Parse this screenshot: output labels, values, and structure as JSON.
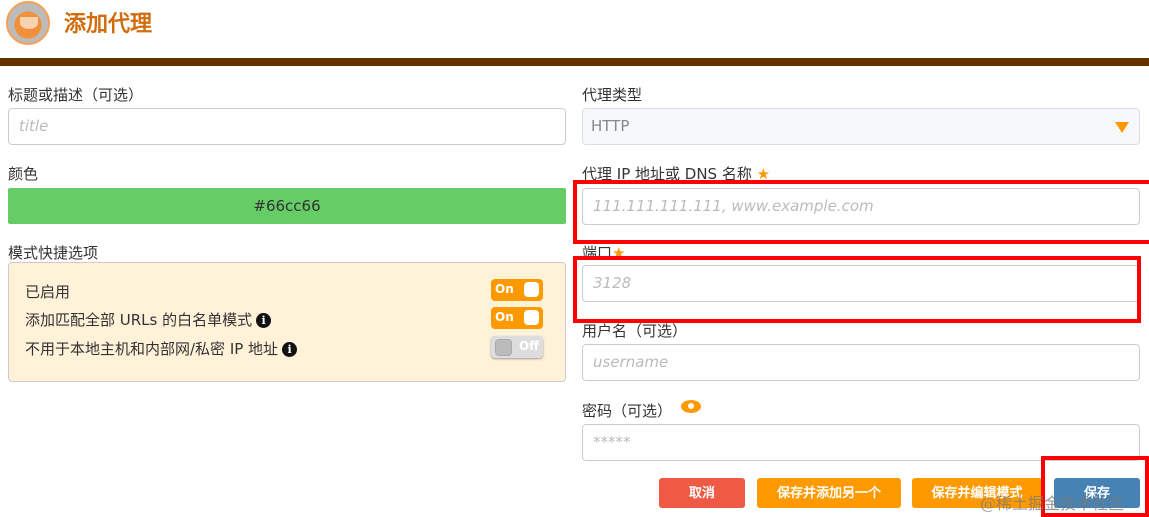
{
  "header": {
    "title": "添加代理",
    "logo": "foxyproxy-fox-logo"
  },
  "left": {
    "title_label": "标题或描述（可选）",
    "title_placeholder": "title",
    "color_label": "颜色",
    "color_value": "#66cc66",
    "pattern_label": "模式快捷选项",
    "options": [
      {
        "label": "已启用",
        "state": "On",
        "info": false
      },
      {
        "label": "添加匹配全部 URLs 的白名单模式",
        "state": "On",
        "info": true
      },
      {
        "label": "不用于本地主机和内部网/私密 IP 地址",
        "state": "Off",
        "info": true
      }
    ]
  },
  "right": {
    "type_label": "代理类型",
    "type_value": "HTTP",
    "host_label": "代理 IP 地址或 DNS 名称",
    "host_placeholder": "111.111.111.111, www.example.com",
    "port_label": "端口",
    "port_placeholder": "3128",
    "user_label": "用户名（可选）",
    "user_placeholder": "username",
    "pass_label": "密码（可选）",
    "pass_placeholder": "*****"
  },
  "buttons": {
    "cancel": "取消",
    "save_add": "保存并添加另一个",
    "save_edit": "保存并编辑模式",
    "save": "保存"
  },
  "colors": {
    "accent": "#ff9900",
    "header_bar": "#663300",
    "title": "#d26d0d",
    "cancel": "#ee5a44",
    "save": "#4682b4",
    "annotation": "#ff0000"
  },
  "watermark": "@稀土掘金技术社区"
}
